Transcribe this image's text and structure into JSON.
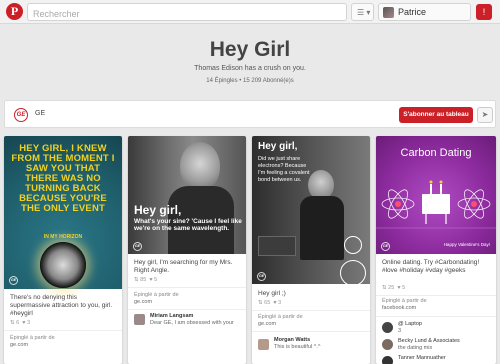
{
  "topbar": {
    "logo": "P",
    "search_placeholder": "Rechercher",
    "menu_icon": "☰ ▾",
    "username": "Patrice",
    "notifications_icon": "!"
  },
  "board": {
    "title": "Hey Girl",
    "description": "Thomas Edison has a crush on you.",
    "stats": "14 Épingles  •  15 209 Abonné(e)s",
    "owner_logo": "GE",
    "owner_name": "GE",
    "follow_label": "S'abonner au tableau",
    "send_icon": "➤"
  },
  "pins": [
    {
      "image_text": "HEY GIRL, I KNEW FROM THE MOMENT I SAW YOU THAT THERE WAS NO TURNING BACK BECAUSE YOU'RE THE ONLY EVENT",
      "image_subtext": "IN MY HORIZON",
      "badge": "GE",
      "text": "There's no denying this supermassive attraction to you, girl. #heygirl",
      "repins": "6",
      "likes": "3",
      "via_label": "Épinglé à partir de",
      "via_source": "ge.com"
    },
    {
      "image_text_1": "Hey girl,",
      "image_text_2": "What's your sine? 'Cause I feel like we're on the same wavelength.",
      "badge": "GE",
      "text": "Hey girl, I'm searching for my Mrs. Right Angle.",
      "repins": "85",
      "likes": "5",
      "via_label": "Épinglé à partir de",
      "via_source": "ge.com",
      "comment_user": "Miriam Langsam",
      "comment_text": "Dear GE, I am obsessed with your"
    },
    {
      "image_text_1": "Hey girl,",
      "image_text_2": "Did we just share electrons? Because I'm feeling a covalent bond between us.",
      "badge": "GE",
      "text": "Hey girl ;)",
      "repins": "65",
      "likes": "3",
      "via_label": "Épinglé à partir de",
      "via_source": "ge.com",
      "comment_user": "Morgan Watts",
      "comment_text": "This is beautiful ^.^"
    },
    {
      "image_text": "Carbon Dating",
      "image_footer": "Happy Valentine's Day!",
      "badge": "GE",
      "text": "Online dating. Try #Carbondating! #love #holiday #vday #geeks",
      "repins": "25",
      "likes": "5",
      "via_label": "Épinglé à partir de",
      "via_source": "facebook.com",
      "boards": [
        {
          "name": "@ Laptop",
          "sub": "3"
        },
        {
          "name": "Becky Lund & Associates",
          "sub": "the dating mix"
        },
        {
          "name": "Tanner Mannuather",
          "sub": ""
        }
      ]
    }
  ],
  "colors": {
    "brand_red": "#cb2027",
    "pin1_bg": "#1f5e6b",
    "pin1_text": "#f2d21f",
    "pin4_bg": "#8b2a9c"
  }
}
